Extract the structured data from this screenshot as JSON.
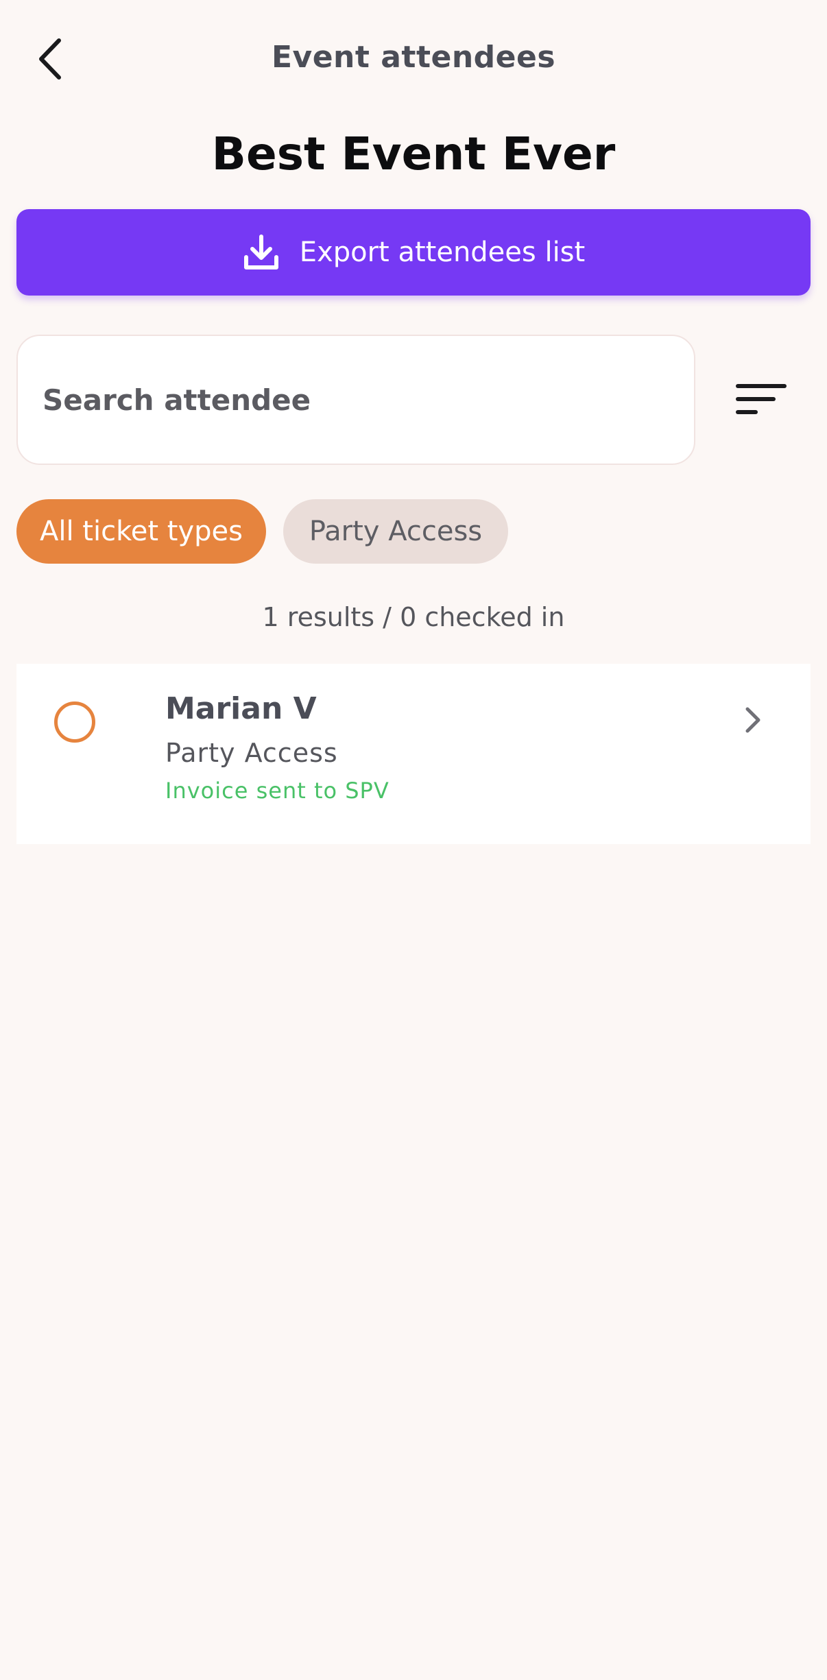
{
  "header": {
    "title": "Event attendees",
    "back_icon": "chevron-left-icon"
  },
  "event": {
    "name": "Best Event Ever"
  },
  "export_button": {
    "label": "Export attendees list",
    "icon": "download-icon",
    "color": "#7639f4"
  },
  "search": {
    "placeholder": "Search attendee",
    "value": ""
  },
  "filter_button": {
    "icon": "filter-sort-icon"
  },
  "ticket_filters": [
    {
      "label": "All ticket types",
      "selected": true,
      "color": "#e6843e"
    },
    {
      "label": "Party Access",
      "selected": false,
      "color": "#eaddd9"
    }
  ],
  "summary": {
    "text": "1 results / 0 checked in"
  },
  "attendees": [
    {
      "name": "Marian V",
      "ticket_type": "Party Access",
      "status": "Invoice sent to SPV",
      "status_color": "#49c167",
      "checked_in": false
    }
  ]
}
